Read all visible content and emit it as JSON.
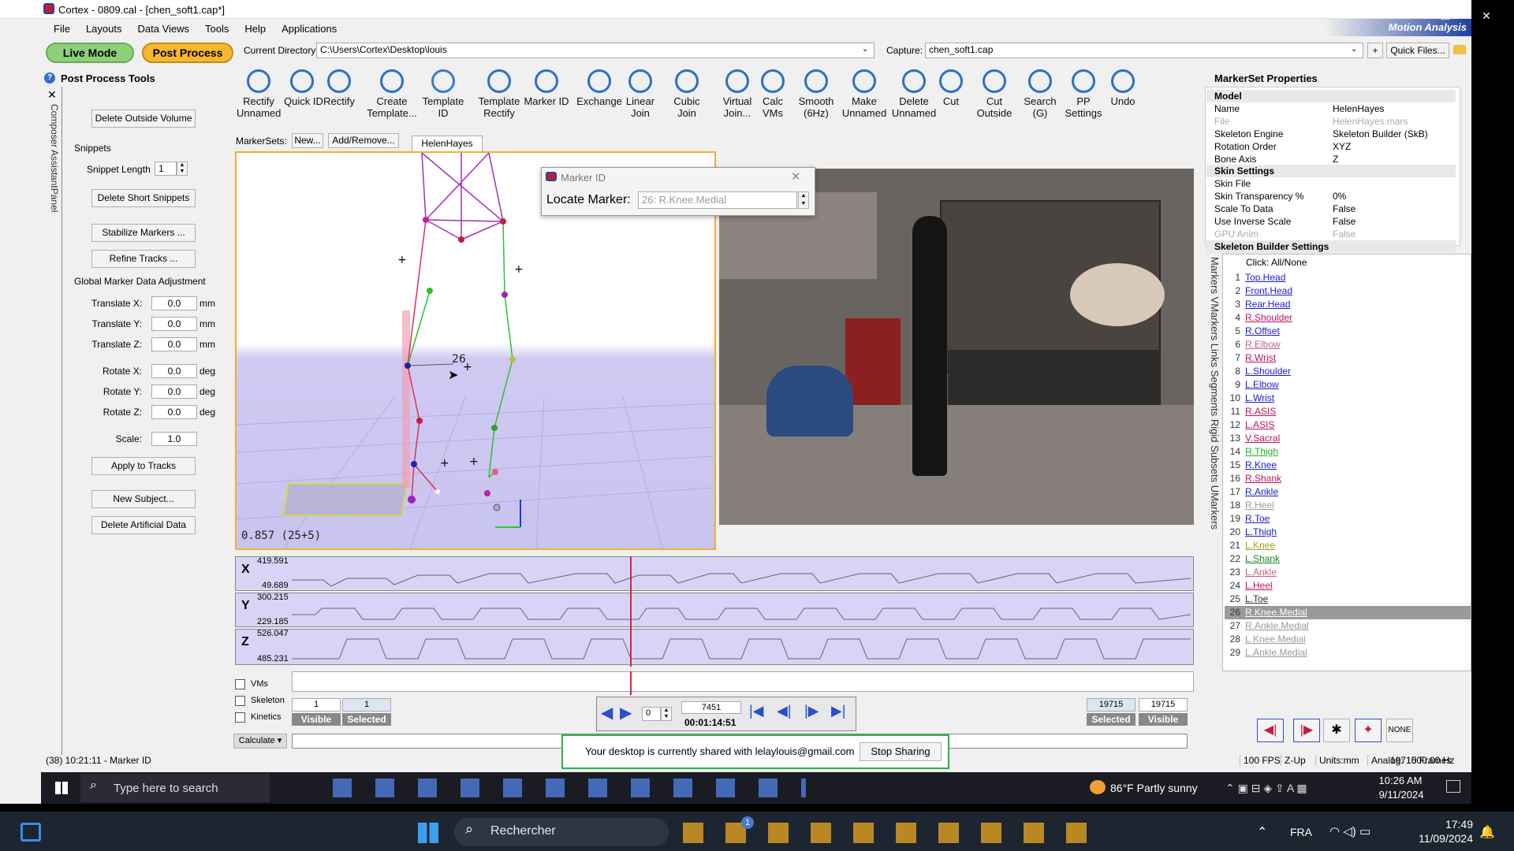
{
  "window": {
    "title": "Cortex - 0809.cal - [chen_soft1.cap*]",
    "controls": [
      "—",
      "❐",
      "✕"
    ]
  },
  "menu": [
    "File",
    "Layouts",
    "Data Views",
    "Tools",
    "Help",
    "Applications"
  ],
  "modes": {
    "live": "Live Mode",
    "post": "Post Process"
  },
  "current_dir": {
    "label": "Current Directory:",
    "value": "C:\\Users\\Cortex\\Desktop\\louis"
  },
  "capture": {
    "label": "Capture:",
    "value": "chen_soft1.cap"
  },
  "quick_files": "Quick Files...",
  "brand": "Motion Analysis",
  "left_panel": {
    "title": "Post Process Tools",
    "vertical_tabs": "Composer AssistantPanel",
    "delete_outside": "Delete Outside Volume",
    "snippets_header": "Snippets",
    "snippet_length_label": "Snippet Length",
    "snippet_length_value": "1",
    "delete_short": "Delete Short Snippets",
    "stabilize": "Stabilize Markers ...",
    "refine": "Refine Tracks ...",
    "gmda_header": "Global Marker Data Adjustment",
    "adjust": [
      {
        "label": "Translate X:",
        "value": "0.0",
        "unit": "mm"
      },
      {
        "label": "Translate Y:",
        "value": "0.0",
        "unit": "mm"
      },
      {
        "label": "Translate Z:",
        "value": "0.0",
        "unit": "mm"
      },
      {
        "label": "Rotate X:",
        "value": "0.0",
        "unit": "deg"
      },
      {
        "label": "Rotate Y:",
        "value": "0.0",
        "unit": "deg"
      },
      {
        "label": "Rotate Z:",
        "value": "0.0",
        "unit": "deg"
      },
      {
        "label": "Scale:",
        "value": "1.0",
        "unit": ""
      }
    ],
    "apply": "Apply to Tracks",
    "new_subject": "New Subject...",
    "delete_artificial": "Delete Artificial Data"
  },
  "toolbar": [
    {
      "label": "Rectify\nUnnamed",
      "icon": "rectify-unnamed-icon"
    },
    {
      "label": "Quick ID",
      "icon": "quick-id-icon"
    },
    {
      "label": "Rectify",
      "icon": "rectify-icon"
    },
    {
      "label": "Create\nTemplate...",
      "icon": "create-template-icon"
    },
    {
      "label": "Template\nID",
      "icon": "template-id-icon"
    },
    {
      "label": "Template\nRectify",
      "icon": "template-rectify-icon"
    },
    {
      "label": "Marker ID",
      "icon": "marker-id-icon"
    },
    {
      "label": "Exchange",
      "icon": "exchange-icon"
    },
    {
      "label": "Linear\nJoin",
      "icon": "linear-join-icon"
    },
    {
      "label": "Cubic\nJoin",
      "icon": "cubic-join-icon"
    },
    {
      "label": "Virtual\nJoin...",
      "icon": "virtual-join-icon"
    },
    {
      "label": "Calc\nVMs",
      "icon": "calc-vms-icon"
    },
    {
      "label": "Smooth\n(6Hz)",
      "icon": "smooth-icon"
    },
    {
      "label": "Make\nUnnamed",
      "icon": "make-unnamed-icon"
    },
    {
      "label": "Delete\nUnnamed",
      "icon": "delete-unnamed-icon"
    },
    {
      "label": "Cut",
      "icon": "cut-icon"
    },
    {
      "label": "Cut\nOutside",
      "icon": "cut-outside-icon"
    },
    {
      "label": "Search\n(G)",
      "icon": "search-icon"
    },
    {
      "label": "PP\nSettings",
      "icon": "pp-settings-icon"
    },
    {
      "label": "Undo",
      "icon": "undo-icon"
    }
  ],
  "markersets": {
    "label": "MarkerSets:",
    "new": "New...",
    "add_remove": "Add/Remove...",
    "tab": "HelenHayes"
  },
  "viewport": {
    "readout": "0.857 (25+5)",
    "marker_tag": "26"
  },
  "marker_id_dialog": {
    "title": "Marker ID",
    "label": "Locate Marker:",
    "value": "26: R.Knee.Medial"
  },
  "graphs": [
    {
      "axis": "X",
      "max": "419.591",
      "min": "49.689"
    },
    {
      "axis": "Y",
      "max": "300.215",
      "min": "229.185"
    },
    {
      "axis": "Z",
      "max": "526.047",
      "min": "485.231"
    }
  ],
  "timeline": {
    "checks": [
      "VMs",
      "Skeleton",
      "Kinetics"
    ],
    "start_visible": "1",
    "start_selected": "1",
    "visible": "Visible",
    "selected": "Selected",
    "frame": "7451",
    "step": "0",
    "time": "00:01:14:51",
    "end_selected": "19715",
    "end_visible": "19715",
    "calculate": "Calculate"
  },
  "share_bar": {
    "text": "Your desktop is currently shared with lelaylouis@gmail.com",
    "stop": "Stop Sharing"
  },
  "status": {
    "left": "(38) 10:21:11 - Marker ID",
    "frames": "19715 Frames",
    "fps": "100 FPS",
    "zup": "Z-Up",
    "units": "Units:mm",
    "analog": "Analog: 1000.00 Hz"
  },
  "props": {
    "title": "MarkerSet Properties",
    "rows": [
      {
        "k": "Model",
        "v": "",
        "group": true
      },
      {
        "k": "Name",
        "v": "HelenHayes"
      },
      {
        "k": "File",
        "v": "HelenHayes.mars",
        "dim": true
      },
      {
        "k": "Skeleton Engine",
        "v": "Skeleton Builder (SkB)"
      },
      {
        "k": "Rotation Order",
        "v": "XYZ"
      },
      {
        "k": "Bone Axis",
        "v": "Z"
      },
      {
        "k": "Skin Settings",
        "v": "",
        "group": true
      },
      {
        "k": "Skin File",
        "v": ""
      },
      {
        "k": "Skin Transparency %",
        "v": "0%"
      },
      {
        "k": "Scale To Data",
        "v": "False"
      },
      {
        "k": "Use Inverse Scale",
        "v": "False"
      },
      {
        "k": "GPU Anim",
        "v": "False",
        "dim": true
      },
      {
        "k": "Skeleton Builder Settings",
        "v": "",
        "group": true
      }
    ]
  },
  "marker_tabs": "Markers VMarkers Links Segments Rigid Subsets UMarkers",
  "marker_list_header": "Click: All/None",
  "markers": [
    {
      "n": "1",
      "t": "Top.Head",
      "c": "#1a1ad0"
    },
    {
      "n": "2",
      "t": "Front.Head",
      "c": "#1a1ad0"
    },
    {
      "n": "3",
      "t": "Rear.Head",
      "c": "#1a1ad0"
    },
    {
      "n": "4",
      "t": "R.Shoulder",
      "c": "#c01060"
    },
    {
      "n": "5",
      "t": "R.Offset",
      "c": "#1a1ad0"
    },
    {
      "n": "6",
      "t": "R.Elbow",
      "c": "#c06080"
    },
    {
      "n": "7",
      "t": "R.Wrist",
      "c": "#c01060"
    },
    {
      "n": "8",
      "t": "L.Shoulder",
      "c": "#1a1ad0"
    },
    {
      "n": "9",
      "t": "L.Elbow",
      "c": "#1a1ad0"
    },
    {
      "n": "10",
      "t": "L.Wrist",
      "c": "#1a1ad0"
    },
    {
      "n": "11",
      "t": "R.ASIS",
      "c": "#c01060"
    },
    {
      "n": "12",
      "t": "L.ASIS",
      "c": "#c01060"
    },
    {
      "n": "13",
      "t": "V.Sacral",
      "c": "#c01060"
    },
    {
      "n": "14",
      "t": "R.Thigh",
      "c": "#20b020"
    },
    {
      "n": "15",
      "t": "R.Knee",
      "c": "#1a1ad0"
    },
    {
      "n": "16",
      "t": "R.Shank",
      "c": "#c01060"
    },
    {
      "n": "17",
      "t": "R.Ankle",
      "c": "#1a1ad0"
    },
    {
      "n": "18",
      "t": "R.Heel",
      "c": "#999999"
    },
    {
      "n": "19",
      "t": "R.Toe",
      "c": "#1a1ad0"
    },
    {
      "n": "20",
      "t": "L.Thigh",
      "c": "#1a1ad0"
    },
    {
      "n": "21",
      "t": "L.Knee",
      "c": "#a0a020"
    },
    {
      "n": "22",
      "t": "L.Shank",
      "c": "#208020"
    },
    {
      "n": "23",
      "t": "L.Ankle",
      "c": "#c06080"
    },
    {
      "n": "24",
      "t": "L.Heel",
      "c": "#c01060"
    },
    {
      "n": "25",
      "t": "L.Toe",
      "c": "#333333"
    },
    {
      "n": "26",
      "t": "R.Knee.Medial",
      "c": "#ffffff",
      "selected": true
    },
    {
      "n": "27",
      "t": "R.Ankle.Medial",
      "c": "#999999"
    },
    {
      "n": "28",
      "t": "L.Knee.Medial",
      "c": "#999999"
    },
    {
      "n": "29",
      "t": "L.Ankle.Medial",
      "c": "#999999"
    }
  ],
  "marker_nav": [
    "◀|",
    "|▶",
    "✱",
    "✦",
    "NONE"
  ],
  "taskbar_inner": {
    "search": "Type here to search",
    "weather": "86°F  Partly sunny",
    "time": "10:26 AM",
    "date": "9/11/2024"
  },
  "taskbar_outer": {
    "search": "Rechercher",
    "lang": "FRA",
    "time": "17:49",
    "date": "11/09/2024",
    "badge": "1"
  }
}
